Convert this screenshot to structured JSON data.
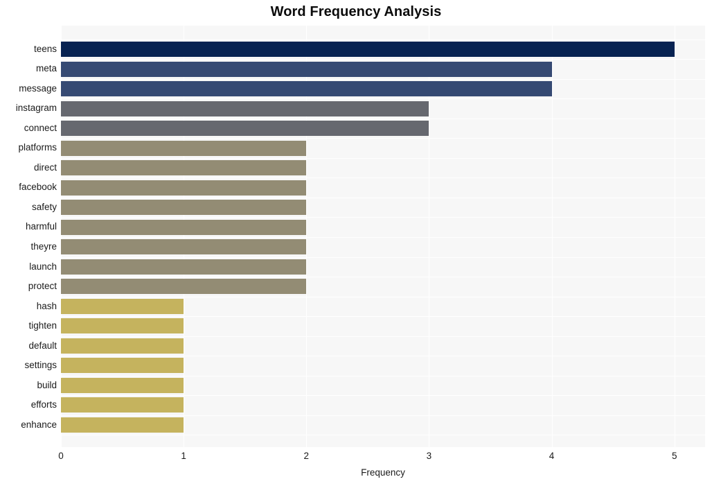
{
  "chart": {
    "title": "Word Frequency Analysis",
    "xlabel": "Frequency",
    "ylabel": ""
  },
  "chart_data": {
    "type": "bar",
    "orientation": "horizontal",
    "title": "Word Frequency Analysis",
    "xlabel": "Frequency",
    "ylabel": "",
    "xlim": [
      0,
      5.25
    ],
    "xticks": [
      0,
      1,
      2,
      3,
      4,
      5
    ],
    "xtick_labels": [
      "0",
      "1",
      "2",
      "3",
      "4",
      "5"
    ],
    "grid": true,
    "legend": "none",
    "categories": [
      "teens",
      "meta",
      "message",
      "instagram",
      "connect",
      "platforms",
      "direct",
      "facebook",
      "safety",
      "harmful",
      "theyre",
      "launch",
      "protect",
      "hash",
      "tighten",
      "default",
      "settings",
      "build",
      "efforts",
      "enhance"
    ],
    "values": [
      5,
      4,
      4,
      3,
      3,
      2,
      2,
      2,
      2,
      2,
      2,
      2,
      2,
      1,
      1,
      1,
      1,
      1,
      1,
      1
    ],
    "bar_colors": [
      "#082352",
      "#364a73",
      "#364a73",
      "#66686f",
      "#66686f",
      "#938c74",
      "#938c74",
      "#938c74",
      "#938c74",
      "#938c74",
      "#938c74",
      "#938c74",
      "#938c74",
      "#c5b35e",
      "#c5b35e",
      "#c5b35e",
      "#c5b35e",
      "#c5b35e",
      "#c5b35e",
      "#c5b35e"
    ],
    "plot_background": "#f7f7f7",
    "grid_color": "#ffffff",
    "figure_background": "#ffffff"
  }
}
